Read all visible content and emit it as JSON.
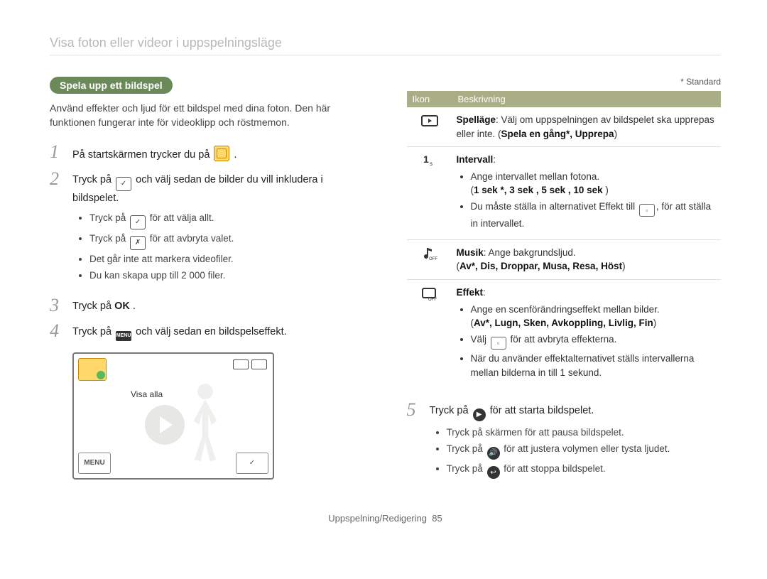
{
  "header": {
    "title": "Visa foton eller videor i uppspelningsläge"
  },
  "left": {
    "section_title": "Spela upp ett bildspel",
    "intro": "Använd effekter och ljud för ett bildspel med dina foton. Den här funktionen fungerar inte för videoklipp och röstmemon.",
    "steps": {
      "1": {
        "pre": "På startskärmen trycker du på ",
        "post": " ."
      },
      "2": {
        "line_pre": "Tryck på ",
        "line_post": " och välj sedan de bilder du vill inkludera i bildspelet.",
        "bullets": [
          {
            "pre": "Tryck på ",
            "post": " för att välja allt."
          },
          {
            "pre": "Tryck på ",
            "post": " för att avbryta valet."
          },
          {
            "plain": "Det går inte att markera videofiler."
          },
          {
            "plain": "Du kan skapa upp till 2 000 filer."
          }
        ]
      },
      "3": {
        "pre": "Tryck på ",
        "ok": "OK",
        "post": " ."
      },
      "4": {
        "pre": "Tryck på ",
        "post": " och välj sedan en bildspelseffekt."
      }
    },
    "screenshot": {
      "visa_alla": "Visa alla",
      "menu": "MENU"
    }
  },
  "right": {
    "standard": "* Standard",
    "table_headers": {
      "ikon": "Ikon",
      "beskrivning": "Beskrivning"
    },
    "rows": {
      "playmode": {
        "title": "Spelläge",
        "text": ": Välj om uppspelningen av bildspelet ska upprepas eller inte. (",
        "opts": "Spela en gång*, Upprepa",
        "end": ")"
      },
      "interval": {
        "title": "Intervall",
        "b1": "Ange intervallet mellan fotona.",
        "opts": "1 sek *, 3 sek , 5 sek , 10 sek ",
        "b2_pre": "Du måste ställa in alternativet Effekt till ",
        "b2_post": ", för att ställa in intervallet."
      },
      "music": {
        "title": "Musik",
        "text": ": Ange bakgrundsljud.",
        "opts": "Av*, Dis, Droppar, Musa, Resa, Höst"
      },
      "effect": {
        "title": "Effekt",
        "b1": "Ange en scenförändringseffekt mellan bilder.",
        "opts": "Av*, Lugn, Sken, Avkoppling, Livlig, Fin",
        "b2_pre": "Välj ",
        "b2_post": " för att avbryta effekterna.",
        "b3": "När du använder effektalternativet ställs intervallerna mellan bilderna in till 1 sekund."
      }
    },
    "step5": {
      "pre": "Tryck på ",
      "post": " för att starta bildspelet.",
      "bullets": {
        "a": "Tryck på skärmen för att pausa bildspelet.",
        "b_pre": "Tryck på ",
        "b_post": " för att justera volymen eller tysta ljudet.",
        "c_pre": "Tryck på ",
        "c_post": " för att stoppa bildspelet."
      }
    }
  },
  "footer": {
    "text": "Uppspelning/Redigering",
    "page": "85"
  }
}
